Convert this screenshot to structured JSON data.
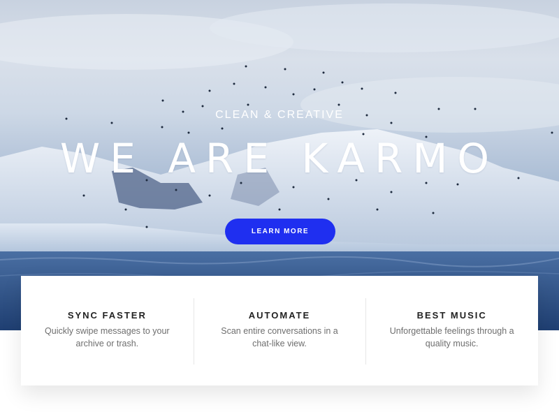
{
  "hero": {
    "tagline": "CLEAN & CREATIVE",
    "headline": "WE ARE KARMO",
    "cta_label": "LEARN MORE",
    "cta_color": "#1f2ff0"
  },
  "features": [
    {
      "title": "SYNC FASTER",
      "text": "Quickly swipe messages to your archive or trash."
    },
    {
      "title": "AUTOMATE",
      "text": "Scan entire conversations in a chat-like view."
    },
    {
      "title": "BEST MUSIC",
      "text": "Unforgettable feelings through a quality music."
    }
  ]
}
